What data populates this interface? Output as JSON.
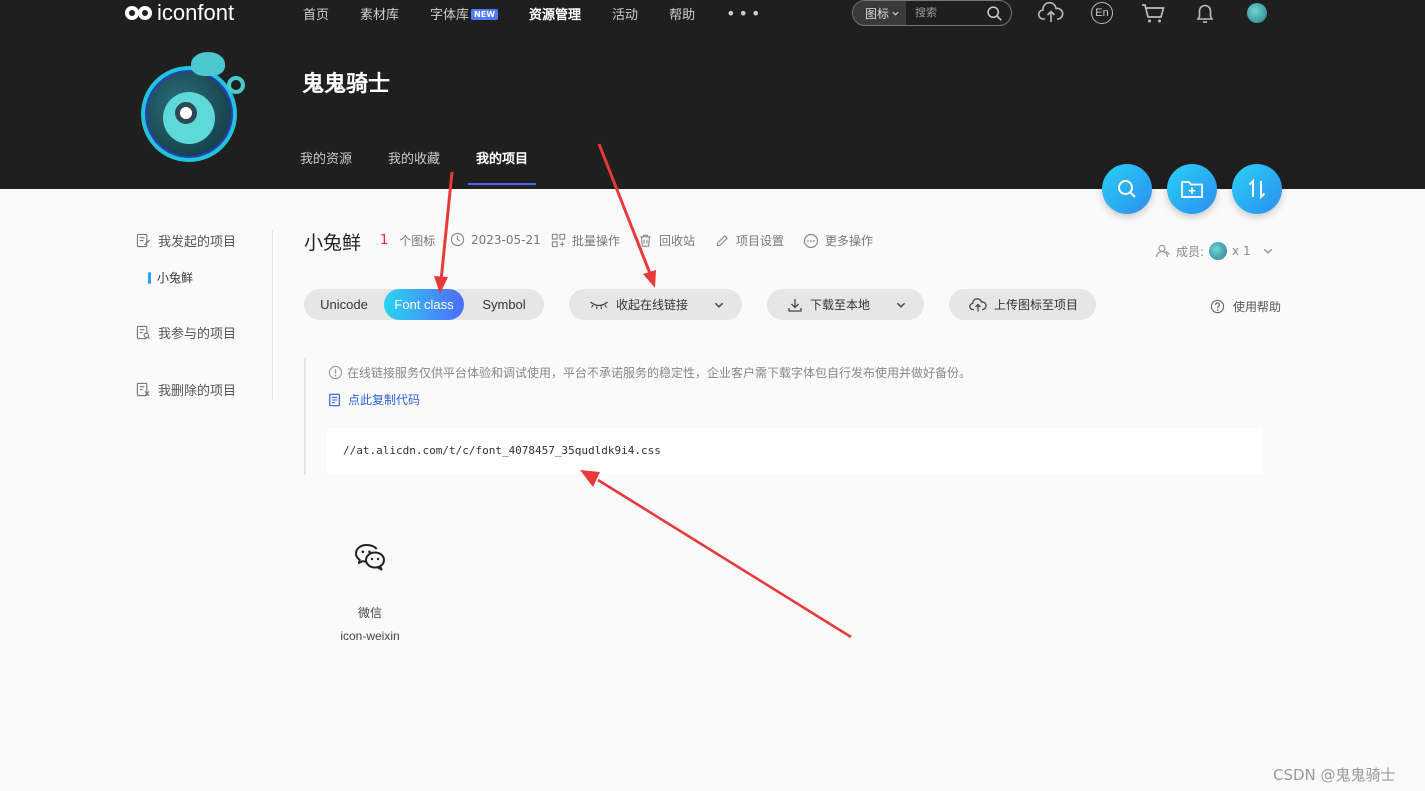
{
  "header": {
    "logo_text": "iconfont",
    "nav": [
      {
        "label": "首页"
      },
      {
        "label": "素材库"
      },
      {
        "label": "字体库",
        "badge": "NEW"
      },
      {
        "label": "资源管理",
        "active": true
      },
      {
        "label": "活动"
      },
      {
        "label": "帮助"
      },
      {
        "label": "•••"
      }
    ],
    "search": {
      "category": "图标",
      "placeholder": "搜索"
    },
    "lang": "En",
    "icons": [
      "upload-cloud-icon",
      "lang-icon",
      "cart-icon",
      "bell-icon",
      "user-avatar"
    ]
  },
  "profile": {
    "name": "鬼鬼骑士",
    "tabs": [
      {
        "label": "我的资源"
      },
      {
        "label": "我的收藏"
      },
      {
        "label": "我的项目",
        "active": true
      }
    ]
  },
  "fab": [
    "search-icon",
    "new-folder-icon",
    "sort-icon"
  ],
  "sidebar": {
    "items": [
      {
        "label": "我发起的项目"
      },
      {
        "label": "我参与的项目"
      },
      {
        "label": "我删除的项目"
      }
    ],
    "active_project": "小兔鲜"
  },
  "project": {
    "title": "小兔鲜",
    "icon_count": "1",
    "icon_count_label": "个图标",
    "date": "2023-05-21",
    "actions": [
      "批量操作",
      "回收站",
      "项目设置",
      "更多操作"
    ],
    "members_label": "成员:",
    "members_count": "x 1"
  },
  "toolbar": {
    "tabs": [
      "Unicode",
      "Font class",
      "Symbol"
    ],
    "active_tab": "Font class",
    "collapse_link": "收起在线链接",
    "download": "下载至本地",
    "upload": "上传图标至项目",
    "help": "使用帮助"
  },
  "notice": {
    "text": "在线链接服务仅供平台体验和调试使用，平台不承诺服务的稳定性，企业客户需下载字体包自行发布使用并做好备份。",
    "copy_code": "点此复制代码",
    "css_url": "//at.alicdn.com/t/c/font_4078457_35qudldk9i4.css"
  },
  "icons": [
    {
      "name": "微信",
      "code": "icon-weixin",
      "glyph": "wechat-icon"
    }
  ],
  "watermark": "CSDN @鬼鬼骑士",
  "colors": {
    "header_bg": "#1f1f1f",
    "accent": "#2bd4ef",
    "accent2": "#4e6cff",
    "arrow": "#e8393b"
  }
}
